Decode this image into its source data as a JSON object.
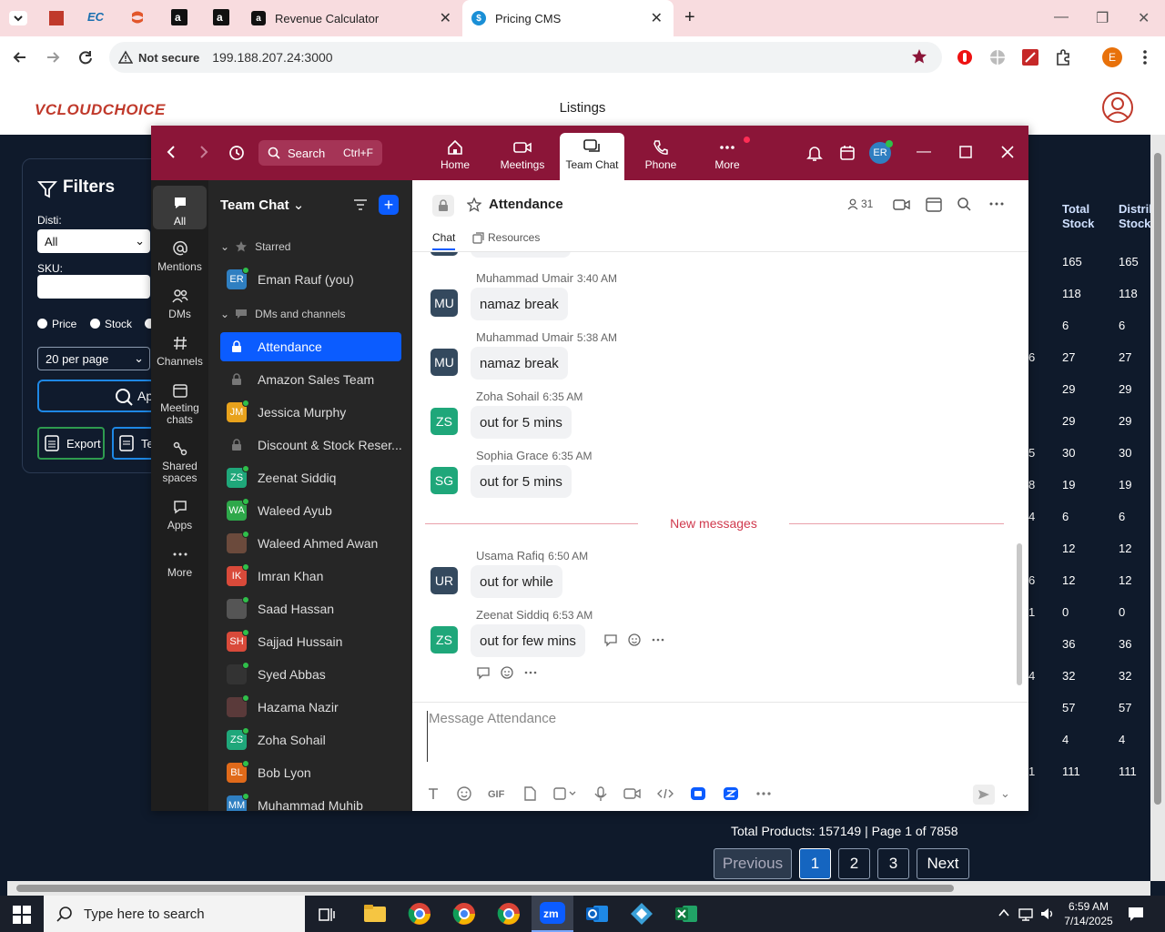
{
  "browser": {
    "tabs": [
      {
        "title": "Revenue Calculator"
      },
      {
        "title": "Pricing CMS"
      }
    ],
    "address": {
      "security_label": "Not secure",
      "url": "199.188.207.24:3000"
    },
    "profile_initial": "E"
  },
  "site": {
    "logo_text": "VCLOUDCHOICE",
    "page_title": "Listings",
    "filters": {
      "title": "Filters",
      "disti_label": "Disti:",
      "disti_value": "All",
      "sku_label": "SKU:",
      "radio_price": "Price",
      "radio_stock": "Stock",
      "per_page": "20 per page",
      "apply_label": "Ap",
      "export_label": "Export",
      "template_label": "Te"
    },
    "table": {
      "headers": [
        "Total\nStock",
        "Distrib\nStock"
      ],
      "rows": [
        {
          "prefix": "",
          "total": "165",
          "distrib": "165"
        },
        {
          "prefix": "",
          "total": "118",
          "distrib": "118"
        },
        {
          "prefix": "",
          "total": "6",
          "distrib": "6"
        },
        {
          "prefix": "6",
          "total": "27",
          "distrib": "27"
        },
        {
          "prefix": "",
          "total": "29",
          "distrib": "29"
        },
        {
          "prefix": "",
          "total": "29",
          "distrib": "29"
        },
        {
          "prefix": "5",
          "total": "30",
          "distrib": "30"
        },
        {
          "prefix": "8",
          "total": "19",
          "distrib": "19"
        },
        {
          "prefix": "4",
          "total": "6",
          "distrib": "6"
        },
        {
          "prefix": "",
          "total": "12",
          "distrib": "12"
        },
        {
          "prefix": "6",
          "total": "12",
          "distrib": "12"
        },
        {
          "prefix": "1",
          "total": "0",
          "distrib": "0"
        },
        {
          "prefix": "",
          "total": "36",
          "distrib": "36"
        },
        {
          "prefix": "4",
          "total": "32",
          "distrib": "32"
        },
        {
          "prefix": "",
          "total": "57",
          "distrib": "57"
        },
        {
          "prefix": "",
          "total": "4",
          "distrib": "4"
        },
        {
          "prefix": "1",
          "total": "111",
          "distrib": "111"
        }
      ]
    },
    "footer": {
      "summary": "Total Products: 157149 | Page 1 of 7858",
      "previous": "Previous",
      "pages": [
        "1",
        "2",
        "3"
      ],
      "next": "Next"
    }
  },
  "zoom": {
    "search_label": "Search",
    "search_shortcut": "Ctrl+F",
    "nav": [
      "Home",
      "Meetings",
      "Team Chat",
      "Phone",
      "More"
    ],
    "user_initials": "ER",
    "rail": [
      "All",
      "Mentions",
      "DMs",
      "Channels",
      "Meeting chats",
      "Shared spaces",
      "Apps",
      "More"
    ],
    "list_title": "Team Chat",
    "starred_label": "Starred",
    "dms_label": "DMs and channels",
    "starred": [
      {
        "initials": "ER",
        "name": "Eman Rauf (you)",
        "color": "#2f7fc1"
      }
    ],
    "channels": [
      {
        "initials": "",
        "name": "Attendance",
        "color": "#0b5cff",
        "lock": true
      },
      {
        "initials": "",
        "name": "Amazon Sales Team",
        "color": "#444",
        "lock": true
      },
      {
        "initials": "JM",
        "name": "Jessica Murphy",
        "color": "#e8a21c"
      },
      {
        "initials": "",
        "name": "Discount & Stock Reser...",
        "color": "#444",
        "lock": true
      },
      {
        "initials": "ZS",
        "name": "Zeenat Siddiq",
        "color": "#1fa77a"
      },
      {
        "initials": "WA",
        "name": "Waleed Ayub",
        "color": "#2ea84a"
      },
      {
        "initials": "",
        "name": "Waleed Ahmed Awan",
        "color": "#6b4a3c"
      },
      {
        "initials": "IK",
        "name": "Imran Khan",
        "color": "#d94a3a"
      },
      {
        "initials": "",
        "name": "Saad Hassan",
        "color": "#555"
      },
      {
        "initials": "SH",
        "name": "Sajjad Hussain",
        "color": "#d94a3a"
      },
      {
        "initials": "",
        "name": "Syed Abbas",
        "color": "#333"
      },
      {
        "initials": "",
        "name": "Hazama Nazir",
        "color": "#5a3a3a"
      },
      {
        "initials": "ZS",
        "name": "Zoha Sohail",
        "color": "#1fa77a"
      },
      {
        "initials": "BL",
        "name": "Bob Lyon",
        "color": "#e06a1a"
      },
      {
        "initials": "MM",
        "name": "Muhammad Muhib",
        "color": "#2f7fc1"
      }
    ],
    "chat": {
      "title": "Attendance",
      "member_count": "31",
      "tabs": [
        "Chat",
        "Resources"
      ],
      "messages": [
        {
          "initials": "MU",
          "name": "Muhammad Umair",
          "time": "3:40 AM",
          "text": "namaz break",
          "color": "#34495e"
        },
        {
          "initials": "MU",
          "name": "Muhammad Umair",
          "time": "5:38 AM",
          "text": "namaz break",
          "color": "#34495e"
        },
        {
          "initials": "ZS",
          "name": "Zoha Sohail",
          "time": "6:35 AM",
          "text": "out for 5 mins",
          "color": "#1fa77a"
        },
        {
          "initials": "SG",
          "name": "Sophia Grace",
          "time": "6:35 AM",
          "text": "out for 5 mins",
          "color": "#1fa77a"
        },
        {
          "initials": "UR",
          "name": "Usama Rafiq",
          "time": "6:50 AM",
          "text": "out for while",
          "color": "#34495e"
        },
        {
          "initials": "ZS",
          "name": "Zeenat Siddiq",
          "time": "6:53 AM",
          "text": "out for few mins",
          "color": "#1fa77a"
        }
      ],
      "new_messages_label": "New messages",
      "composer_placeholder": "Message Attendance"
    }
  },
  "taskbar": {
    "search_placeholder": "Type here to search",
    "time": "6:59 AM",
    "date": "7/14/2025"
  },
  "colors": {
    "zoom_brand": "#8b1538",
    "accent_blue": "#0b5cff",
    "online": "#2fbf4a",
    "new_messages": "#d0394d"
  }
}
